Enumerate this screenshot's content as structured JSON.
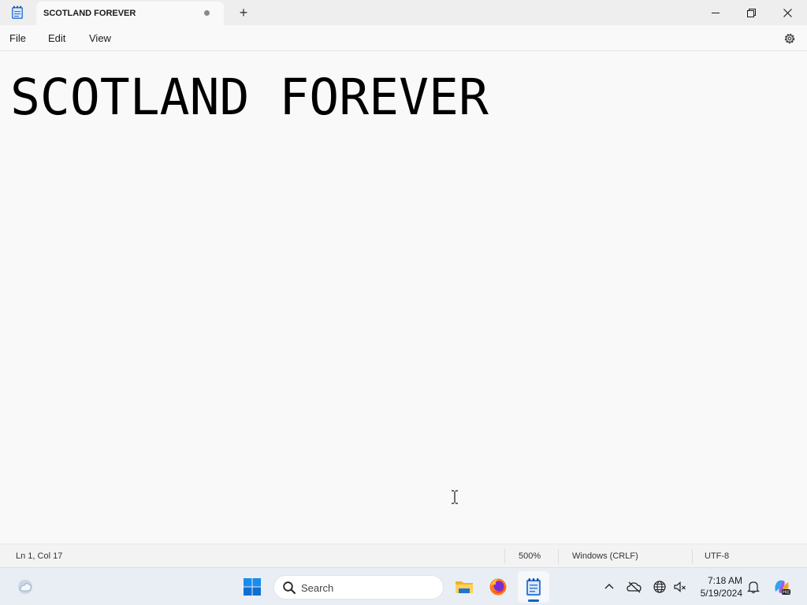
{
  "window": {
    "tab_title": "SCOTLAND FOREVER",
    "new_tab_symbol": "+",
    "unsaved_indicator": true
  },
  "menu": {
    "items": [
      "File",
      "Edit",
      "View"
    ]
  },
  "editor": {
    "content": "SCOTLAND FOREVER"
  },
  "status": {
    "position": "Ln 1, Col 17",
    "zoom": "500%",
    "line_ending": "Windows (CRLF)",
    "encoding": "UTF-8"
  },
  "taskbar": {
    "search_placeholder": "Search",
    "time": "7:18 AM",
    "date": "5/19/2024",
    "pinned_apps": [
      "start-icon",
      "file-explorer-icon",
      "firefox-icon",
      "notepad-icon"
    ],
    "tray_icons": [
      "chevron-up-icon",
      "onedrive-icon",
      "network-icon",
      "volume-icon",
      "bell-icon",
      "copilot-icon"
    ]
  },
  "colors": {
    "accent": "#0067c0",
    "editor_bg": "#f9f9f9",
    "titlebar_bg": "#eeeeee",
    "taskbar_bg": "#e9eef5"
  }
}
